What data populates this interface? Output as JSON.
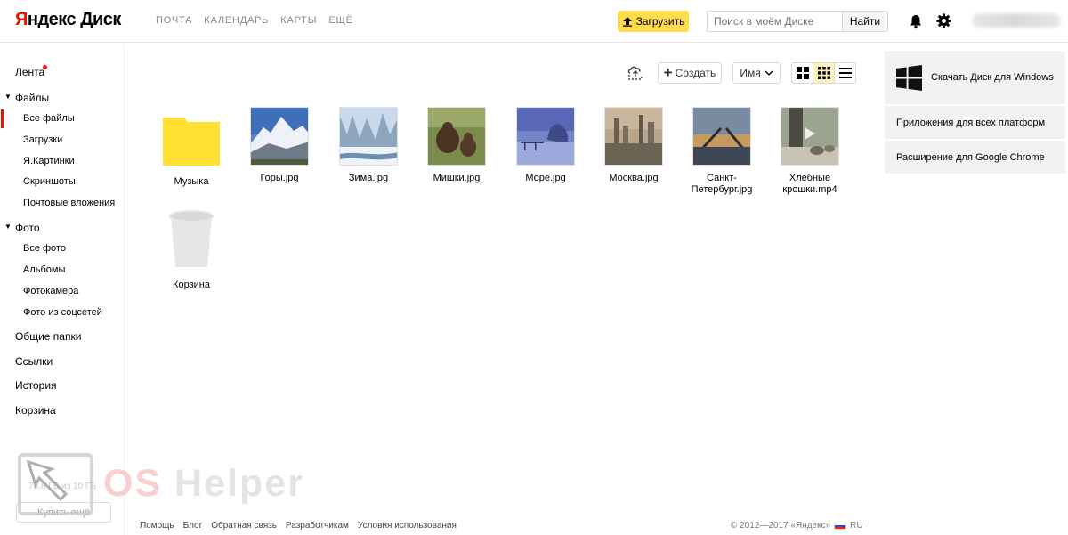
{
  "header": {
    "logo_first": "Я",
    "logo_rest": "ндекс Диск",
    "nav": [
      "ПОЧТА",
      "КАЛЕНДАРЬ",
      "КАРТЫ",
      "ЕЩЁ"
    ],
    "upload_label": "Загрузить",
    "search_placeholder": "Поиск в моём Диске",
    "search_button": "Найти"
  },
  "sidebar": {
    "feed": "Лента",
    "files": "Файлы",
    "files_items": [
      "Все файлы",
      "Загрузки",
      "Я.Картинки",
      "Скриншоты",
      "Почтовые вложения"
    ],
    "photo": "Фото",
    "photo_items": [
      "Все фото",
      "Альбомы",
      "Фотокамера",
      "Фото из соцсетей"
    ],
    "other": [
      "Общие папки",
      "Ссылки",
      "История",
      "Корзина"
    ],
    "quota": "78,8 ГБ из 10 ГБ",
    "buy_more": "Купить ещё"
  },
  "toolbar": {
    "create_label": "Создать",
    "sort_label": "Имя"
  },
  "files": [
    {
      "name": "Музыка",
      "type": "folder"
    },
    {
      "name": "Горы.jpg",
      "type": "image"
    },
    {
      "name": "Зима.jpg",
      "type": "image"
    },
    {
      "name": "Мишки.jpg",
      "type": "image"
    },
    {
      "name": "Море.jpg",
      "type": "image"
    },
    {
      "name": "Москва.jpg",
      "type": "image"
    },
    {
      "name": "Санкт-\nПетербург.jpg",
      "type": "image"
    },
    {
      "name": "Хлебные\nкрошки.mp4",
      "type": "video"
    },
    {
      "name": "Корзина",
      "type": "trash"
    }
  ],
  "right_panel": {
    "download_windows": "Скачать Диск для Windows",
    "apps_all": "Приложения для всех платформ",
    "chrome_ext": "Расширение для Google Chrome"
  },
  "footer": {
    "links": [
      "Помощь",
      "Блог",
      "Обратная связь",
      "Разработчикам",
      "Условия использования"
    ],
    "copyright": "© 2012—2017 «Яндекс»",
    "lang": "RU"
  },
  "watermark": {
    "os": "OS",
    "helper": "Helper"
  },
  "colors": {
    "accent_yellow": "#ffdb4d",
    "brand_red": "#e61400",
    "folder_yellow": "#ffe033"
  }
}
